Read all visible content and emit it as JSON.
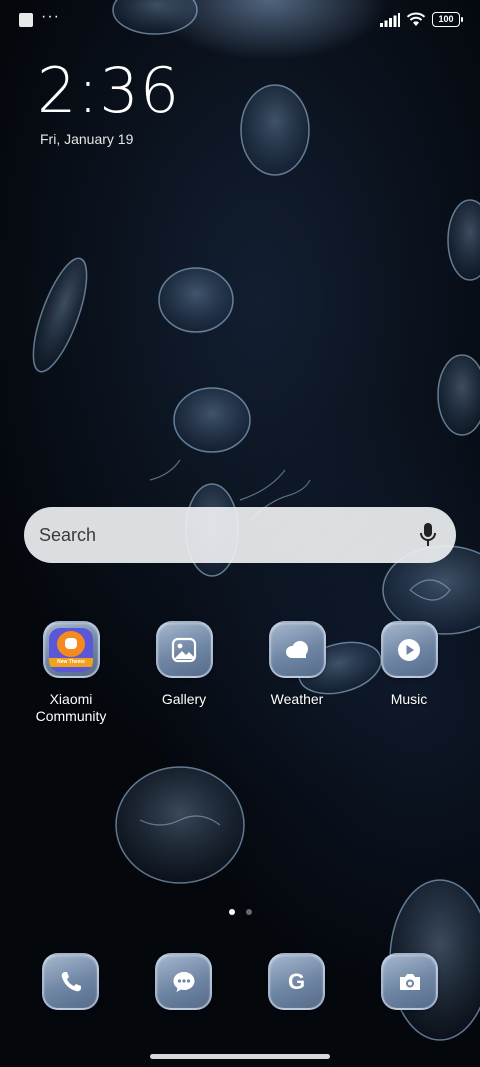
{
  "status_bar": {
    "notification_more": "···",
    "battery_level": "100",
    "signal_icon": "signal-icon",
    "wifi_icon": "wifi-icon"
  },
  "lock": {
    "time": "2:36",
    "date": "Fri, January 19"
  },
  "search": {
    "label": "Search",
    "mic_icon": "mic-icon"
  },
  "apps": [
    {
      "label_line1": "Xiaomi",
      "label_line2": "Community",
      "icon": "xiaomi-community-icon",
      "badge_text": "New Theme"
    },
    {
      "label": "Gallery",
      "icon": "gallery-icon"
    },
    {
      "label": "Weather",
      "icon": "weather-icon"
    },
    {
      "label": "Music",
      "icon": "music-icon"
    }
  ],
  "page_indicator": {
    "pages": 2,
    "current": 1
  },
  "dock": [
    {
      "icon": "phone-icon"
    },
    {
      "icon": "messages-icon"
    },
    {
      "icon": "google-icon",
      "glyph": "G"
    },
    {
      "icon": "camera-icon"
    }
  ],
  "colors": {
    "background": "#04070c",
    "icon_tint_top": "#a5b7cd",
    "icon_tint_bottom": "#566c8a",
    "search_bg": "#eceef0"
  }
}
